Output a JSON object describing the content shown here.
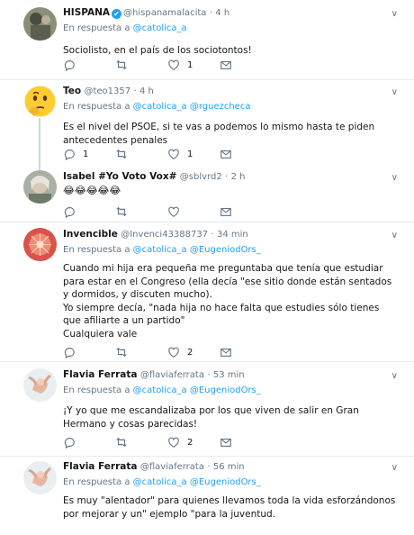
{
  "tweets": [
    {
      "name": "HISPANA",
      "verified_badge": "✔",
      "handle": "@hispanamalacita",
      "dot": "·",
      "time": "4 h",
      "reply_prefix": "En respuesta a ",
      "reply_to": "@catolica_a",
      "text_lines": [
        "Sociolisto, en el país de los sociotontos!"
      ],
      "replies": "",
      "retweets": "",
      "likes": "1"
    },
    {
      "name": "Teo",
      "handle": "@teo1357",
      "dot": "·",
      "time": "4 h",
      "reply_prefix": "En respuesta a ",
      "reply_to": "@catolica_a @rguezcheca",
      "text_lines": [
        "Es el nivel del PSOE, si te vas a podemos lo mismo hasta te piden antecedentes penales"
      ],
      "replies": "1",
      "retweets": "",
      "likes": "1"
    },
    {
      "name": "Isabel #Yo Voto Vox#",
      "handle": "@sblvrd2",
      "dot": "·",
      "time": "2 h",
      "text_lines": [
        "😂😂😂😂😂"
      ],
      "replies": "",
      "retweets": "",
      "likes": ""
    },
    {
      "name": "Invencible",
      "handle": "@Invenci43388737",
      "dot": "·",
      "time": "34 min",
      "reply_prefix": "En respuesta a ",
      "reply_to": "@catolica_a @EugeniodOrs_",
      "text_lines": [
        "Cuando mi hija era pequeña me preguntaba que tenía que estudiar para estar en el Congreso (ella decía \"ese sitio donde están sentados y dormidos, y discuten mucho).",
        "Yo siempre decía, \"nada hija no hace falta que estudies sólo tienes que afiliarte a un partido\"",
        "Cualquiera vale"
      ],
      "replies": "",
      "retweets": "",
      "likes": "2"
    },
    {
      "name": "Flavia Ferrata",
      "handle": "@flaviaferrata",
      "dot": "·",
      "time": "53 min",
      "reply_prefix": "En respuesta a ",
      "reply_to": "@catolica_a @EugeniodOrs_",
      "text_lines": [
        "¡Y yo que me escandalizaba por los que viven de salir en Gran Hermano y cosas parecidas!"
      ],
      "replies": "",
      "retweets": "",
      "likes": "2"
    },
    {
      "name": "Flavia Ferrata",
      "handle": "@flaviaferrata",
      "dot": "·",
      "time": "56 min",
      "reply_prefix": "En respuesta a ",
      "reply_to": "@catolica_a @EugeniodOrs_",
      "text_lines": [
        "Es muy \"alentador\" para quienes llevamos toda la vida esforzándonos por mejorar y un\" ejemplo \"para la juventud."
      ],
      "replies": "",
      "retweets": "",
      "likes": ""
    }
  ],
  "colors": {
    "link": "#1da1f2",
    "muted": "#657786",
    "text": "#14171a",
    "separator": "#e6ecf0"
  },
  "icons": {
    "reply": "reply-icon",
    "retweet": "retweet-icon",
    "like": "heart-icon",
    "dm": "envelope-icon",
    "more": "chevron-down-icon"
  }
}
